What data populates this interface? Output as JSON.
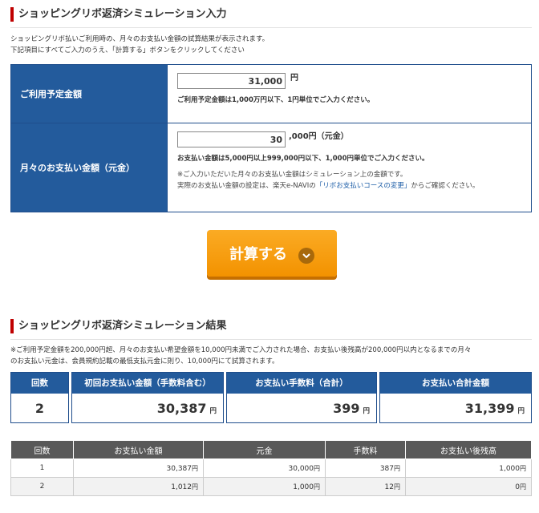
{
  "input_section": {
    "title": "ショッピングリボ返済シミュレーション入力",
    "intro_line1": "ショッピングリボ払いご利用時の、月々のお支払い金額の試算結果が表示されます。",
    "intro_line2": "下記項目にすべてご入力のうえ、「計算する」ボタンをクリックしてください",
    "planned_amount": {
      "label": "ご利用予定金額",
      "value": "31,000",
      "unit": "円",
      "note": "ご利用予定金額は1,000万円以下、1円単位でご入力ください。"
    },
    "monthly_payment": {
      "label": "月々のお支払い金額（元金）",
      "value": "30",
      "unit": ",000円（元金）",
      "note": "お支払い金額は5,000円以上999,000円以下、1,000円単位でご入力ください。",
      "sub_note1": "※ご入力いただいた月々のお支払い金額はシミュレーション上の金額です。",
      "sub_note2_prefix": "実際のお支払い金額の設定は、楽天e-NAVIの",
      "sub_note2_link": "「リボお支払いコースの変更」",
      "sub_note2_suffix": "からご確認ください。"
    },
    "calculate_label": "計算する"
  },
  "result_section": {
    "title": "ショッピングリボ返済シミュレーション結果",
    "note_line1": "※ご利用予定金額を200,000円超、月々のお支払い希望金額を10,000円未満でご入力された場合、お支払い後残高が200,000円以内となるまでの月々",
    "note_line2": "のお支払い元金は、会員規約記載の最低支払元金に則り、10,000円にて試算されます。",
    "summary": {
      "count_label": "回数",
      "count_value": "2",
      "first_label": "初回お支払い金額（手数料含む）",
      "first_value": "30,387",
      "fee_label": "お支払い手数料（合計）",
      "fee_value": "399",
      "total_label": "お支払い合計金額",
      "total_value": "31,399",
      "yen": "円"
    },
    "table": {
      "headers": [
        "回数",
        "お支払い金額",
        "元金",
        "手数料",
        "お支払い後残高"
      ],
      "rows": [
        [
          "1",
          "30,387",
          "30,000",
          "387",
          "1,000"
        ],
        [
          "2",
          "1,012",
          "1,000",
          "12",
          "0"
        ]
      ],
      "yen": "円"
    }
  }
}
